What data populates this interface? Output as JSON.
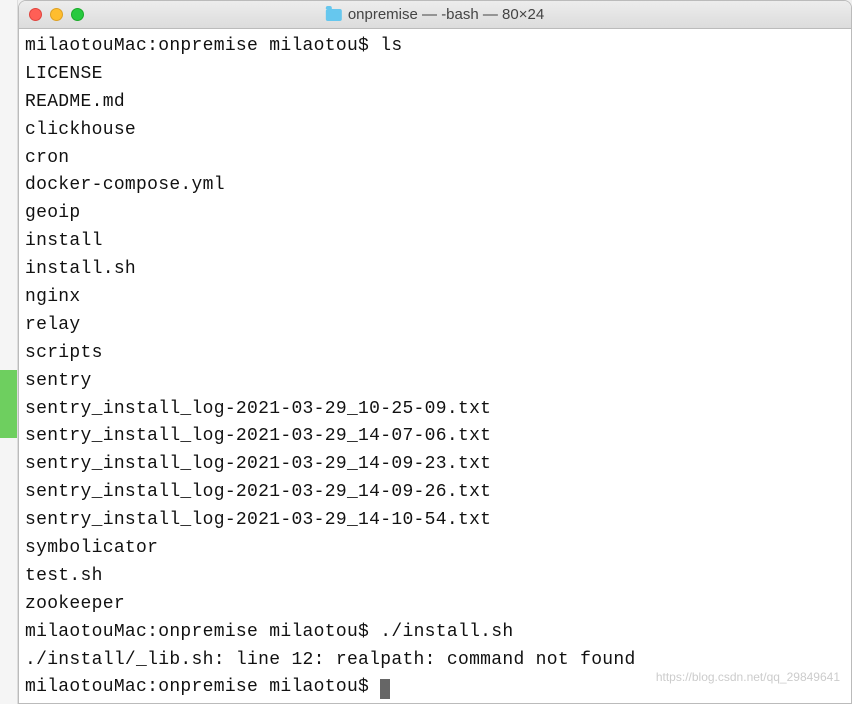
{
  "window": {
    "title": "onpremise — -bash — 80×24"
  },
  "terminal": {
    "prompt1": "milaotouMac:onpremise milaotou$ ",
    "cmd1": "ls",
    "ls_output": [
      "LICENSE",
      "README.md",
      "clickhouse",
      "cron",
      "docker-compose.yml",
      "geoip",
      "install",
      "install.sh",
      "nginx",
      "relay",
      "scripts",
      "sentry",
      "sentry_install_log-2021-03-29_10-25-09.txt",
      "sentry_install_log-2021-03-29_14-07-06.txt",
      "sentry_install_log-2021-03-29_14-09-23.txt",
      "sentry_install_log-2021-03-29_14-09-26.txt",
      "sentry_install_log-2021-03-29_14-10-54.txt",
      "symbolicator",
      "test.sh",
      "zookeeper"
    ],
    "prompt2": "milaotouMac:onpremise milaotou$ ",
    "cmd2": "./install.sh",
    "error_line": "./install/_lib.sh: line 12: realpath: command not found",
    "prompt3": "milaotouMac:onpremise milaotou$ "
  },
  "watermark": "https://blog.csdn.net/qq_29849641"
}
